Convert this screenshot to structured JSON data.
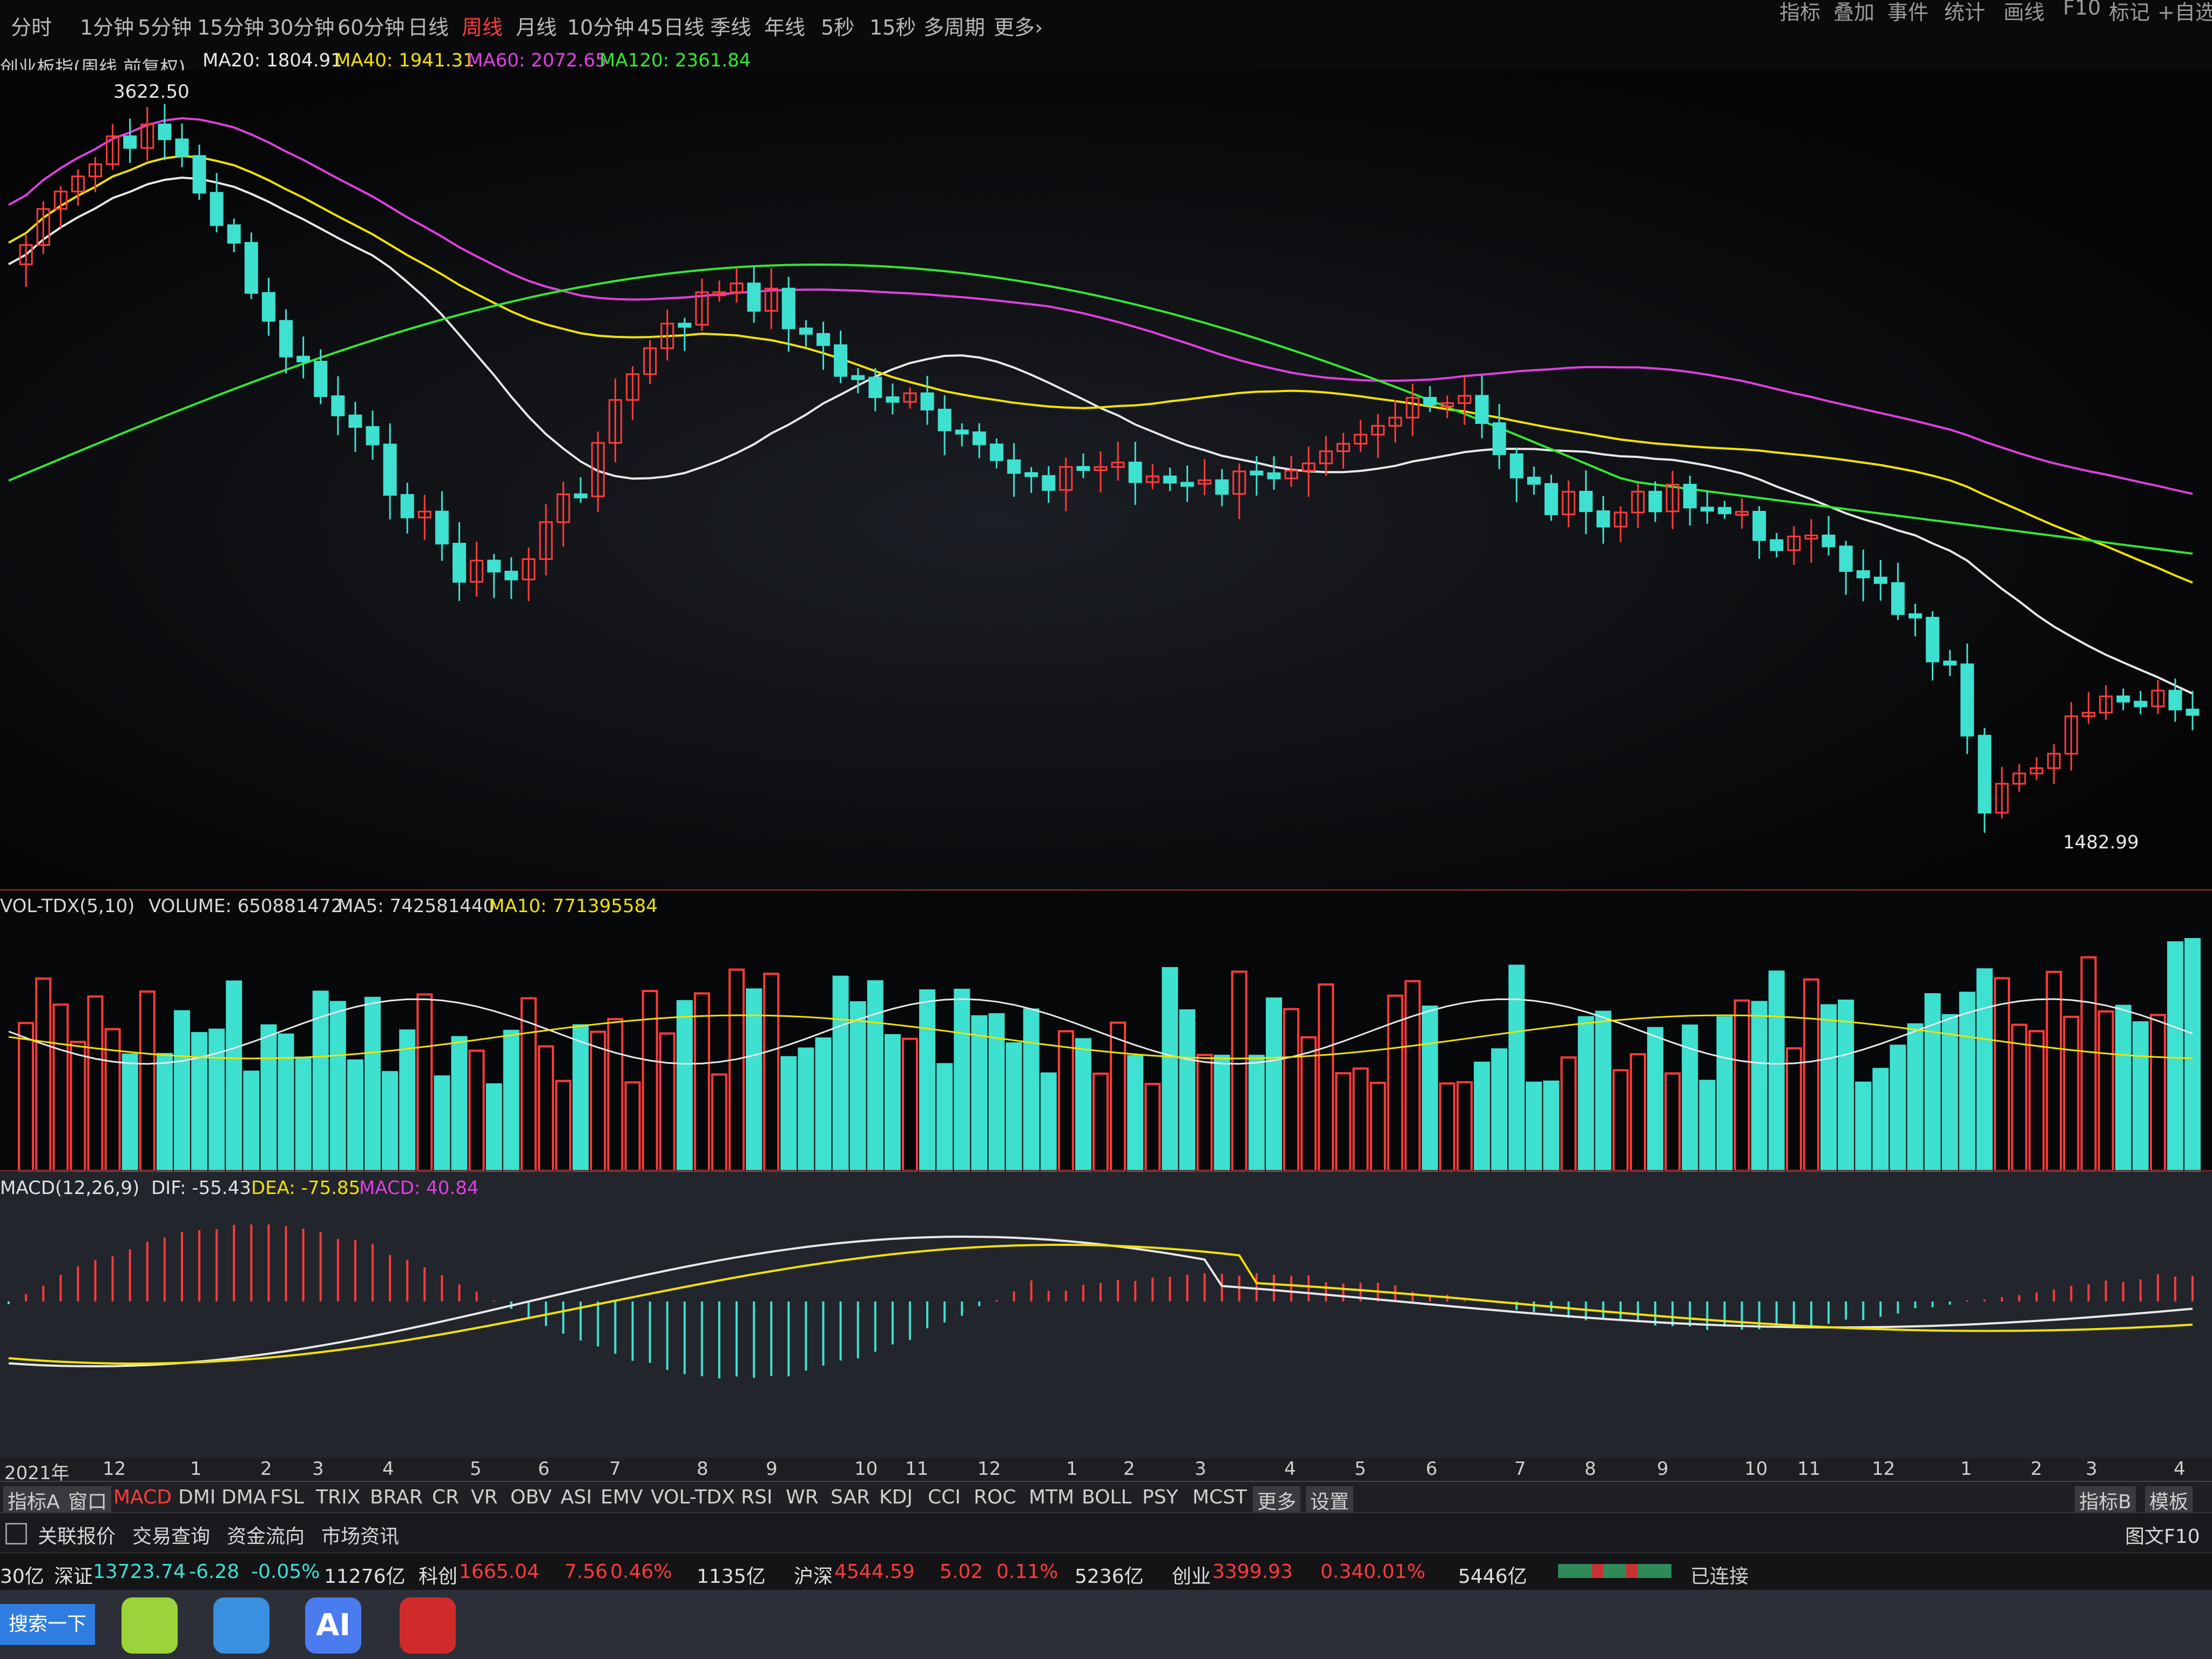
{
  "toolbar": {
    "periods": [
      "分时",
      "1分钟",
      "5分钟",
      "15分钟",
      "30分钟",
      "60分钟",
      "日线",
      "周线",
      "月线",
      "10分钟",
      "45日线",
      "季线",
      "年线",
      "5秒",
      "15秒",
      "多周期",
      "更多"
    ],
    "active_period": "周线",
    "more_chevron": "›",
    "right_tools": [
      "指标",
      "叠加",
      "事件",
      "统计",
      "画线",
      "F10",
      "标记",
      "+自选"
    ]
  },
  "price_panel": {
    "title": "创业板指(周线 前复权)",
    "ma_legend": [
      {
        "label": "MA20: 1804.91",
        "color": "#e8e8e8"
      },
      {
        "label": "MA40: 1941.31",
        "color": "#f2e200"
      },
      {
        "label": "MA60: 2072.65",
        "color": "#e040e0"
      },
      {
        "label": "MA120: 2361.84",
        "color": "#33e833"
      }
    ],
    "high_label": "3622.50",
    "low_label": "1482.99",
    "up_color": "#ff3b3b",
    "down_color": "#3ee0d0"
  },
  "volume_panel": {
    "legend_name": "VOL-TDX(5,10)",
    "legend_volume": "VOLUME: 650881472",
    "legend_ma5": "MA5: 742581440",
    "legend_ma10": "MA10: 771395584"
  },
  "macd_panel": {
    "legend_name": "MACD(12,26,9)",
    "legend_dif": "DIF: -55.43",
    "legend_dea": "DEA: -75.85",
    "legend_macd": "MACD: 40.84"
  },
  "x_axis": {
    "labels": [
      "2021年",
      "12",
      "1",
      "2",
      "3",
      "4",
      "5",
      "6",
      "7",
      "8",
      "9",
      "10",
      "11",
      "12",
      "1",
      "2",
      "3",
      "4",
      "5",
      "6",
      "7",
      "8",
      "9",
      "10",
      "11",
      "12",
      "1",
      "2",
      "3",
      "4"
    ]
  },
  "indicator_tabs": {
    "left": [
      "指标A",
      "窗口",
      "MACD",
      "DMI",
      "DMA",
      "FSL",
      "TRIX",
      "BRAR",
      "CR",
      "VR",
      "OBV",
      "ASI",
      "EMV",
      "VOL-TDX",
      "RSI",
      "WR",
      "SAR",
      "KDJ",
      "CCI",
      "ROC",
      "MTM",
      "BOLL",
      "PSY",
      "MCST",
      "更多",
      "设置"
    ],
    "active": "MACD",
    "right": [
      "指标B",
      "模板"
    ]
  },
  "function_bar": {
    "buttons": [
      "关联报价",
      "交易查询",
      "资金流向",
      "市场资讯"
    ],
    "f10": "图文F10"
  },
  "status_bar": {
    "lead": "30亿",
    "sz_name": "深证",
    "sz_value": "13723.74",
    "sz_change": "-6.28",
    "sz_pct": "-0.05%",
    "sz_amount": "11276亿",
    "kc_name": "科创",
    "kc_value": "1665.04",
    "kc_change": "7.56",
    "kc_pct": "0.46%",
    "kc_amount": "1135亿",
    "hs_name": "沪深",
    "hs_value": "4544.59",
    "hs_change": "5.02",
    "hs_pct": "0.11%",
    "hs_amount": "5236亿",
    "cy_name": "创业",
    "cy_value": "3399.93",
    "cy_change": "0.34",
    "cy_pct": "0.01%",
    "cy_amount": "5446亿",
    "right_text": "已连接"
  },
  "taskbar": {
    "search_label": "搜索一下",
    "ai_label": "AI"
  }
}
